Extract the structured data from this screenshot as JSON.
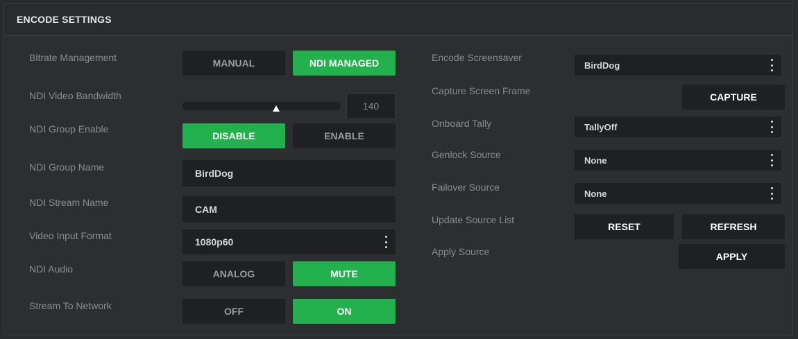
{
  "header": {
    "title": "ENCODE SETTINGS"
  },
  "left": {
    "bitrate": {
      "label": "Bitrate Management",
      "manual": "MANUAL",
      "ndi_managed": "NDI MANAGED",
      "selected": "NDI MANAGED"
    },
    "bandwidth": {
      "label": "NDI Video Bandwidth",
      "value": "140"
    },
    "group_enable": {
      "label": "NDI Group Enable",
      "disable": "DISABLE",
      "enable": "ENABLE",
      "selected": "DISABLE"
    },
    "group_name": {
      "label": "NDI Group Name",
      "value": "BirdDog"
    },
    "stream_name": {
      "label": "NDI Stream Name",
      "value": "CAM"
    },
    "video_format": {
      "label": "Video Input Format",
      "value": "1080p60"
    },
    "audio": {
      "label": "NDI Audio",
      "analog": "ANALOG",
      "mute": "MUTE",
      "selected": "MUTE"
    },
    "stream_network": {
      "label": "Stream To Network",
      "off": "OFF",
      "on": "ON",
      "selected": "ON"
    }
  },
  "right": {
    "screensaver": {
      "label": "Encode Screensaver",
      "value": "BirdDog"
    },
    "capture": {
      "label": "Capture Screen Frame",
      "button": "CAPTURE"
    },
    "tally": {
      "label": "Onboard Tally",
      "value": "TallyOff"
    },
    "genlock": {
      "label": "Genlock Source",
      "value": "None"
    },
    "failover": {
      "label": "Failover Source",
      "value": "None"
    },
    "update_list": {
      "label": "Update Source List",
      "reset": "RESET",
      "refresh": "REFRESH"
    },
    "apply": {
      "label": "Apply Source",
      "button": "APPLY"
    }
  },
  "colors": {
    "accent": "#22b14c",
    "background": "#2d2e30",
    "control": "#1f2022",
    "label": "#8a8c8f"
  },
  "icons": {
    "dropdown": "kebab-menu-icon",
    "slider": "slider-thumb-icon"
  }
}
